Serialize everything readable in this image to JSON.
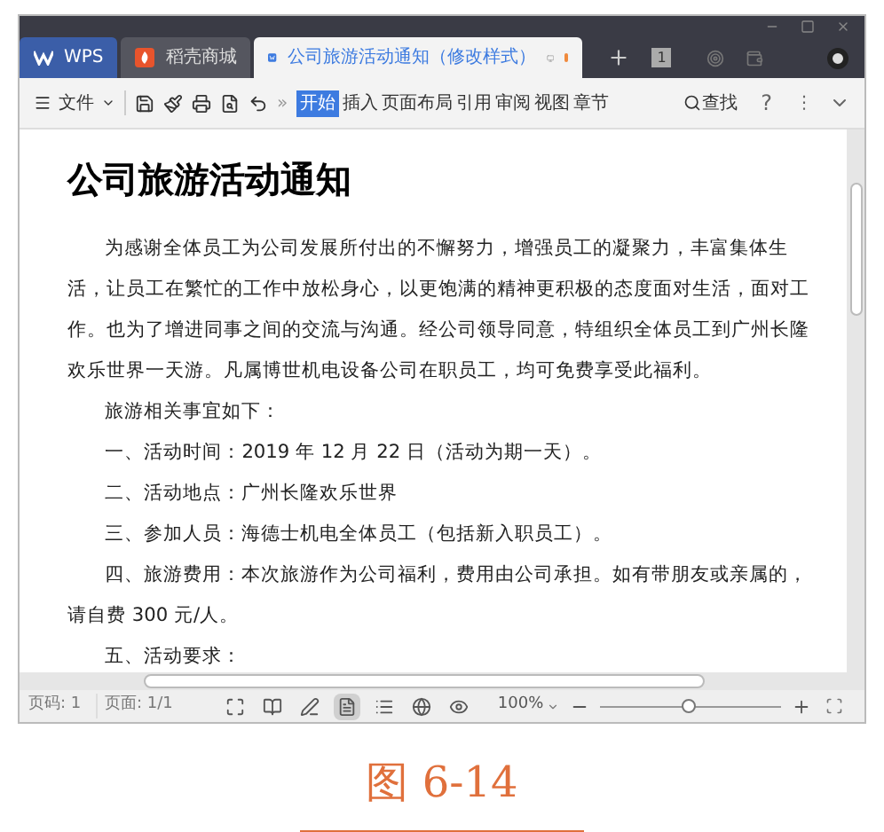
{
  "tabs": [
    {
      "label": "WPS",
      "kind": "home",
      "selected": false
    },
    {
      "label": "稻壳商城",
      "kind": "store",
      "selected": false
    },
    {
      "label": "公司旅游活动通知（修改样式）",
      "kind": "doc",
      "selected": true,
      "unsaved": true
    }
  ],
  "tab_count": "1",
  "toolbar": {
    "file_menu": "文件",
    "overflow": "»",
    "ribbon_tabs": [
      {
        "label": "开始",
        "selected": true
      },
      {
        "label": "插入",
        "selected": false
      },
      {
        "label": "页面布局",
        "selected": false
      },
      {
        "label": "引用",
        "selected": false
      },
      {
        "label": "审阅",
        "selected": false
      },
      {
        "label": "视图",
        "selected": false
      },
      {
        "label": "章节",
        "selected": false
      }
    ],
    "search": "查找",
    "help": "?",
    "more": "⋮"
  },
  "document": {
    "title": "公司旅游活动通知",
    "paragraphs": [
      "为感谢全体员工为公司发展所付出的不懈努力，增强员工的凝聚力，丰富集体生活，让员工在繁忙的工作中放松身心，以更饱满的精神更积极的态度面对生活，面对工作。也为了增进同事之间的交流与沟通。经公司领导同意，特组织全体员工到广州长隆欢乐世界一天游。凡属博世机电设备公司在职员工，均可免费享受此福利。",
      "旅游相关事宜如下：",
      "一、活动时间：2019 年 12 月 22 日（活动为期一天）。",
      "二、活动地点：广州长隆欢乐世界",
      "三、参加人员：海德士机电全体员工（包括新入职员工）。",
      "四、旅游费用：本次旅游作为公司福利，费用由公司承担。如有带朋友或亲属的，请自费 300 元/人。",
      "五、活动要求："
    ]
  },
  "status_bar": {
    "page_number": "页码: 1",
    "pages": "页面: 1/1",
    "view_modes": [
      {
        "kind": "fullscreen",
        "selected": false
      },
      {
        "kind": "reading",
        "selected": false
      },
      {
        "kind": "writing",
        "selected": false
      },
      {
        "kind": "page",
        "selected": true
      },
      {
        "kind": "outline",
        "selected": false
      },
      {
        "kind": "web",
        "selected": false
      },
      {
        "kind": "eye",
        "selected": false
      }
    ],
    "zoom": "100%",
    "zoom_slider": {
      "level": 0.49
    }
  },
  "caption": "图 6-14"
}
